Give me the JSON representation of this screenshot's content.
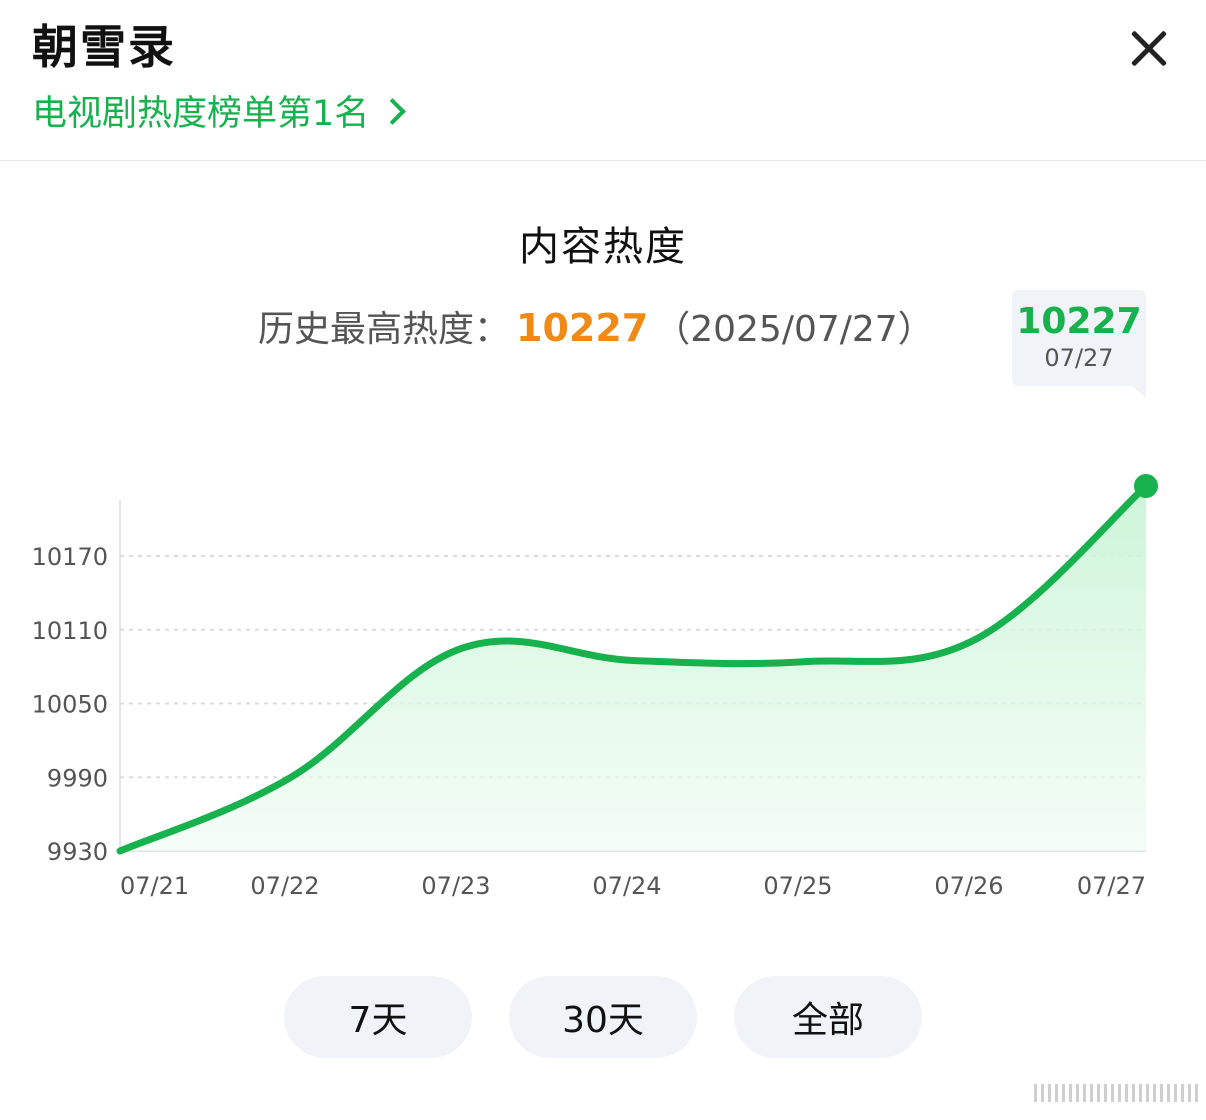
{
  "header": {
    "title": "朝雪录",
    "rank_link": "电视剧热度榜单第1名"
  },
  "section": {
    "title": "内容热度",
    "record_label": "历史最高热度：",
    "record_value": "10227",
    "record_date": "（2025/07/27）"
  },
  "tooltip": {
    "value": "10227",
    "date": "07/27"
  },
  "range_buttons": [
    {
      "label": "7天",
      "active": true
    },
    {
      "label": "30天",
      "active": false
    },
    {
      "label": "全部",
      "active": false
    }
  ],
  "colors": {
    "accent": "#17b24d",
    "highlight": "#f08a16",
    "grid": "#d9dde2",
    "axis_text": "#555555"
  },
  "chart_data": {
    "type": "area",
    "title": "",
    "xlabel": "",
    "ylabel": "",
    "categories": [
      "07/21",
      "07/22",
      "07/23",
      "07/24",
      "07/25",
      "07/26",
      "07/27"
    ],
    "values": [
      9930,
      9990,
      10095,
      10085,
      10084,
      10102,
      10227
    ],
    "yticks": [
      9930,
      9990,
      10050,
      10110,
      10170
    ],
    "ylim": [
      9930,
      10227
    ],
    "grid": true,
    "highlight_last_point": true
  }
}
